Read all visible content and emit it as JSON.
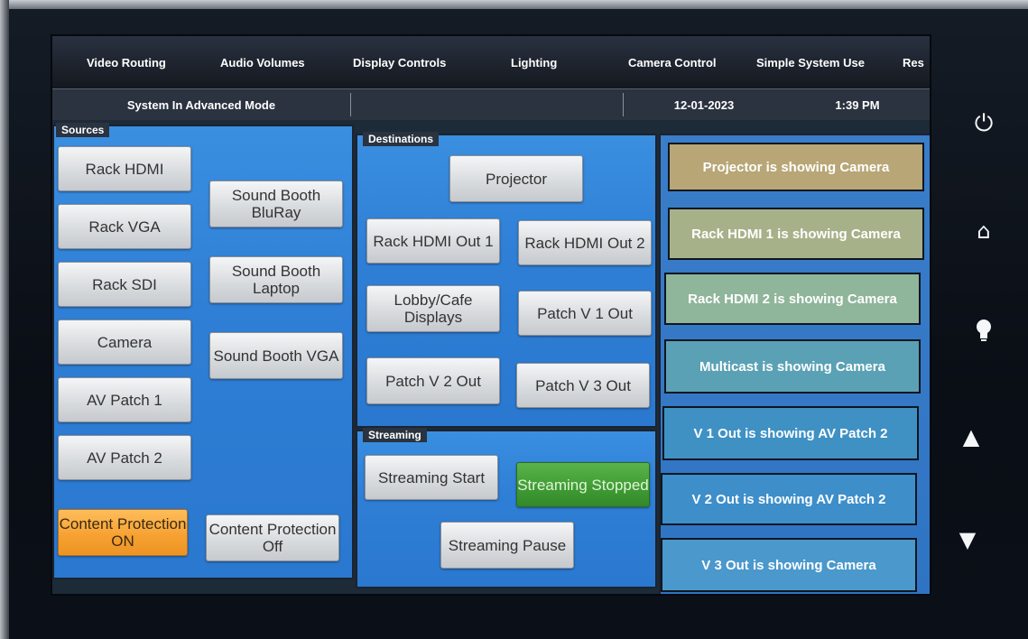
{
  "nav": {
    "tabs": [
      {
        "label": "Video Routing"
      },
      {
        "label": "Audio Volumes"
      },
      {
        "label": "Display Controls"
      },
      {
        "label": "Lighting"
      },
      {
        "label": "Camera Control"
      },
      {
        "label": "Simple System Use"
      },
      {
        "label": "Res"
      }
    ]
  },
  "status": {
    "mode": "System In Advanced Mode",
    "date": "12-01-2023",
    "time": "1:39 PM"
  },
  "sources": {
    "title": "Sources",
    "left_buttons": [
      {
        "label": "Rack HDMI"
      },
      {
        "label": "Rack VGA"
      },
      {
        "label": "Rack SDI"
      },
      {
        "label": "Camera"
      },
      {
        "label": "AV Patch 1"
      },
      {
        "label": "AV Patch 2"
      }
    ],
    "right_buttons": [
      {
        "label": "Sound Booth BluRay"
      },
      {
        "label": "Sound Booth Laptop"
      },
      {
        "label": "Sound Booth VGA"
      }
    ],
    "content_protection_on": "Content Protection ON",
    "content_protection_off": "Content Protection Off"
  },
  "destinations": {
    "title": "Destinations",
    "projector": "Projector",
    "rack_hdmi_out_1": "Rack HDMI Out 1",
    "rack_hdmi_out_2": "Rack HDMI Out 2",
    "lobby_cafe": "Lobby/Cafe Displays",
    "patch_v1": "Patch V 1 Out",
    "patch_v2": "Patch V 2 Out",
    "patch_v3": "Patch V 3 Out"
  },
  "streaming": {
    "title": "Streaming",
    "start": "Streaming Start",
    "stopped": "Streaming Stopped",
    "pause": "Streaming Pause"
  },
  "route_status": [
    {
      "text": "Projector is showing Camera",
      "color": "#b8a676"
    },
    {
      "text": "Rack HDMI 1 is showing Camera",
      "color": "#a7b189"
    },
    {
      "text": "Rack HDMI 2 is showing Camera",
      "color": "#8fb59a"
    },
    {
      "text": "Multicast is showing Camera",
      "color": "#5ba1b5"
    },
    {
      "text": "V 1 Out is showing AV Patch 2",
      "color": "#3f91c4"
    },
    {
      "text": "V 2 Out is showing AV Patch 2",
      "color": "#3d8ec9"
    },
    {
      "text": "V 3 Out is showing Camera",
      "color": "#4a98cc"
    }
  ],
  "side_controls": {
    "power": "power-icon",
    "home": "home-icon",
    "lights": "lightbulb-icon",
    "up": "up-arrow-icon",
    "down": "down-arrow-icon"
  },
  "colors": {
    "panel_blue": "#2f7fd6",
    "content_protection_on": "#f5a030",
    "streaming_stopped": "#3f9a33"
  }
}
